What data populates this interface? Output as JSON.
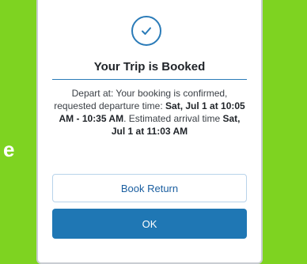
{
  "background": {
    "fragment_text": "e",
    "color": "#7ED321"
  },
  "dialog": {
    "icon": "check-circle-icon",
    "title": "Your Trip is Booked",
    "message": {
      "intro": "Depart at: Your booking is confirmed, requested departure time: ",
      "departure": "Sat, Jul 1 at 10:05 AM - 10:35 AM",
      "middle": ". Estimated arrival time ",
      "arrival": "Sat, Jul 1 at 11:03 AM"
    },
    "book_return_label": "Book Return",
    "ok_label": "OK",
    "accent": "#1f77b4"
  }
}
